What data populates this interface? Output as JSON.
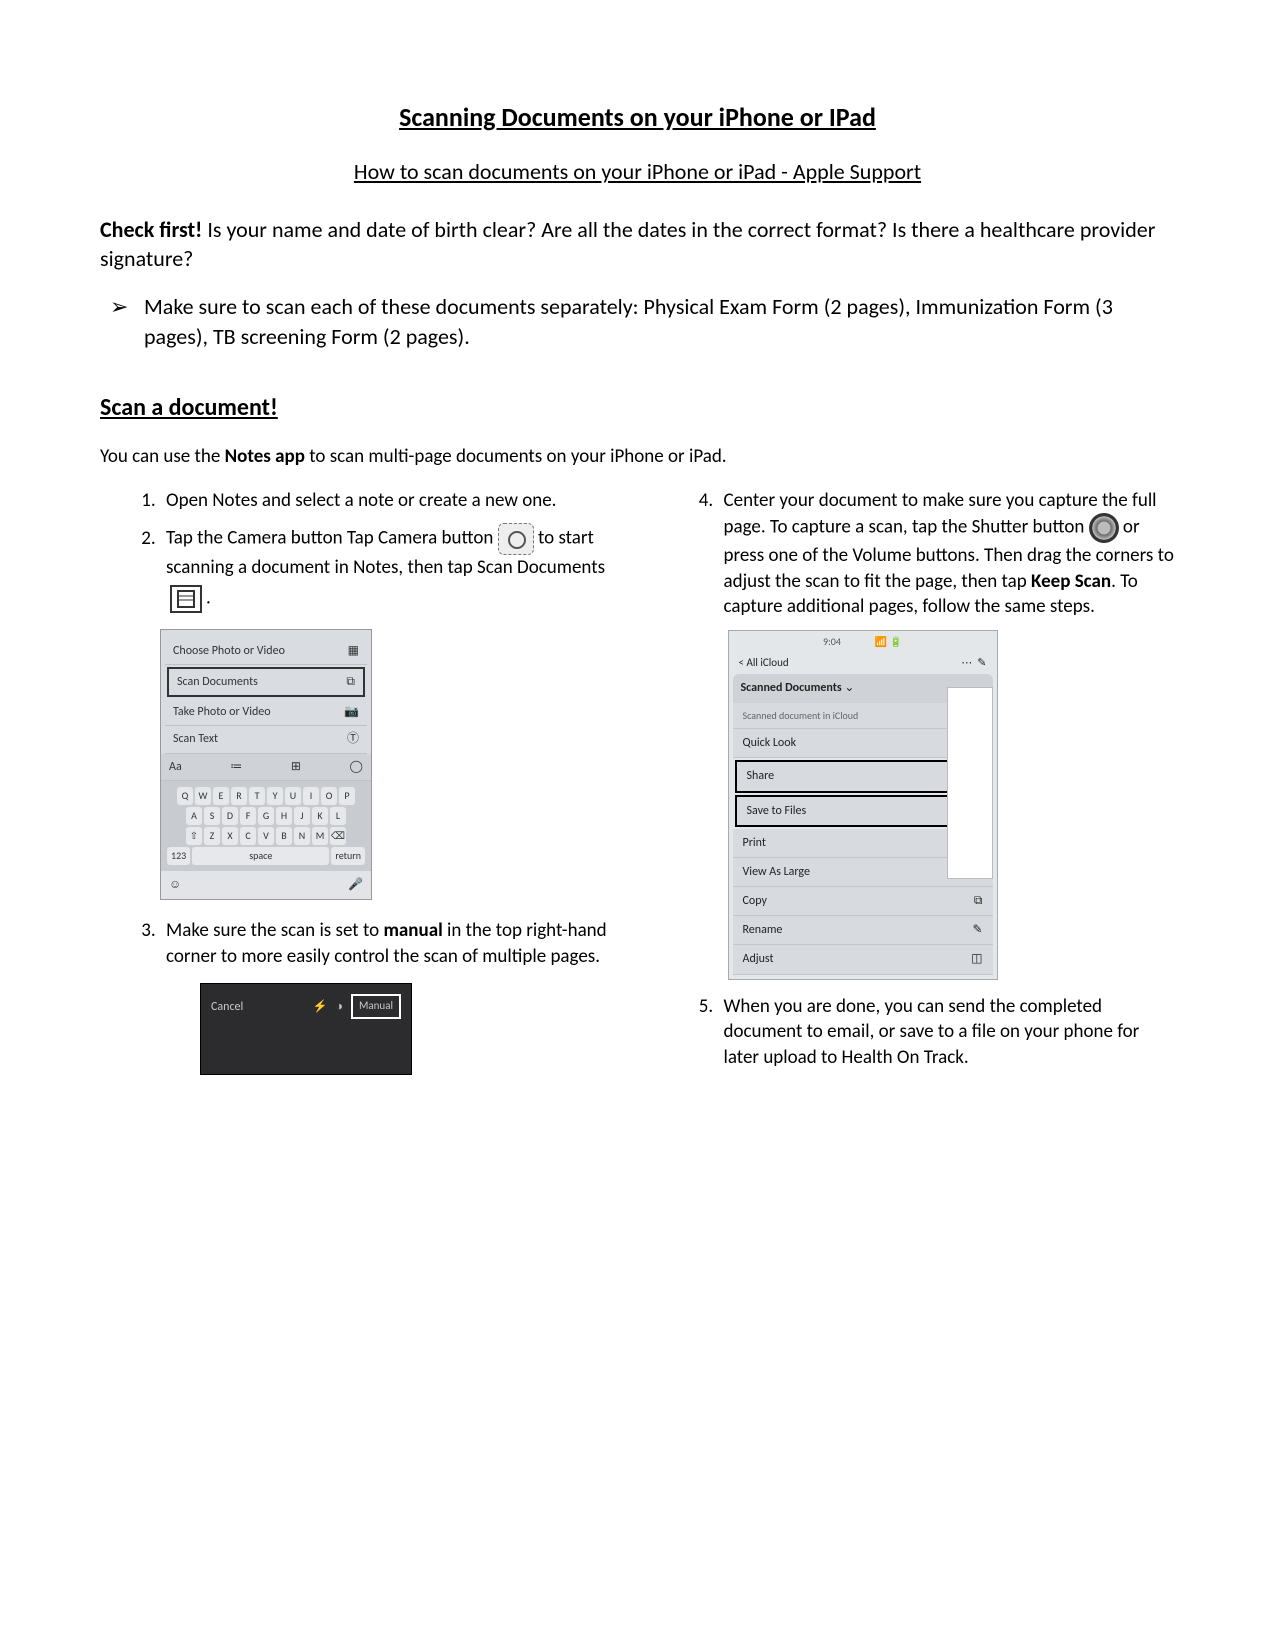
{
  "title": "Scanning Documents on your iPhone or IPad",
  "subtitle": "How to scan documents on your iPhone or iPad - Apple Support",
  "intro_bold": "Check first!",
  "intro_rest": " Is your name and date of birth clear? Are all the dates in the correct format? Is there a healthcare provider signature?",
  "bullet": "Make sure to scan each of these documents separately: Physical Exam Form (2 pages), Immunization Form (3 pages), TB screening Form (2 pages).",
  "section_head": "Scan a document!",
  "section_sub_a": "You can use the ",
  "section_sub_b": "Notes app",
  "section_sub_c": " to scan multi-page documents on your iPhone or iPad.",
  "steps": {
    "s1": "Open Notes and select a note or create a new one.",
    "s2a": "Tap the Camera button Tap Camera button",
    "s2b": " to start scanning a document in Notes, then tap Scan Documents ",
    "s3a": "Make sure the scan is set to ",
    "s3b": "manual",
    "s3c": " in the top right-hand corner to more easily control the scan of multiple pages.",
    "s4a": "Center your document to make sure you capture the full page. To capture a scan, tap the Shutter button ",
    "s4b": " or press one of the Volume buttons. Then drag the corners to adjust the scan to fit the page, then tap ",
    "s4c": "Keep Scan",
    "s4d": ". To capture additional pages, follow the same steps.",
    "s5": "When you are done, you can send the completed document to email, or save to a file on your phone for later upload to Health On Track."
  },
  "menu": {
    "choose": "Choose Photo or Video",
    "scan_docs": "Scan Documents",
    "take": "Take Photo or Video",
    "scan_text": "Scan Text",
    "aa": "Aa",
    "space": "space",
    "return": "return"
  },
  "dark": {
    "cancel": "Cancel",
    "manual": "Manual"
  },
  "share": {
    "time": "9:04",
    "back": "< All iCloud",
    "title": "Scanned Documents",
    "sub": "Scanned document in iCloud",
    "quick": "Quick Look",
    "share_label": "Share",
    "save": "Save to Files",
    "print": "Print",
    "view": "View As Large",
    "copy": "Copy",
    "rename": "Rename",
    "adjust": "Adjust"
  },
  "keys_row1": [
    "Q",
    "W",
    "E",
    "R",
    "T",
    "Y",
    "U",
    "I",
    "O",
    "P"
  ],
  "keys_row2": [
    "A",
    "S",
    "D",
    "F",
    "G",
    "H",
    "J",
    "K",
    "L"
  ],
  "keys_row3": [
    "⇧",
    "Z",
    "X",
    "C",
    "V",
    "B",
    "N",
    "M",
    "⌫"
  ]
}
